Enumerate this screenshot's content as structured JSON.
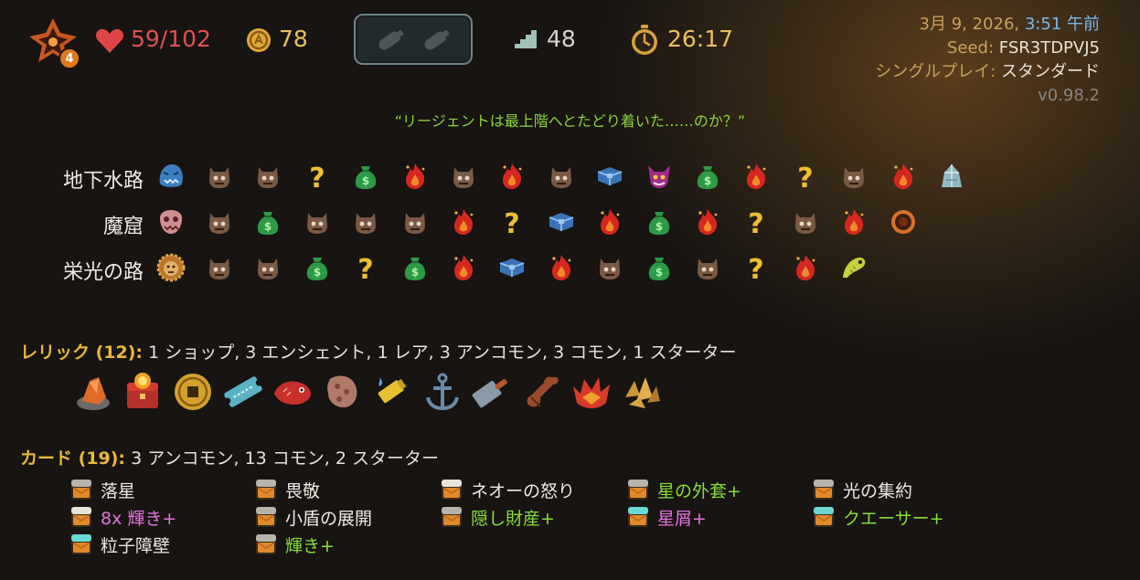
{
  "top_bar": {
    "ascension": "4",
    "hp": "59/102",
    "gold": "78",
    "floor": "48",
    "timer": "26:17",
    "potions": [
      "potion-slot-1-icon",
      "potion-slot-2-icon"
    ]
  },
  "info": {
    "date": "3月 9, 2026, ",
    "time": "3:51 午前",
    "seed_label": "Seed: ",
    "seed": "FSR3TDPVJ5",
    "mode_label": "シングルプレイ: ",
    "mode": "スタンダード",
    "version": "v0.98.2"
  },
  "quote": "“リージェントは最上階へとたどり着いた……のか？”",
  "acts": [
    {
      "name": "地下水路",
      "boss_icon": "blue-slime-boss-icon",
      "nodes": [
        "monster",
        "monster",
        "unknown",
        "shop",
        "elite",
        "monster",
        "elite",
        "monster",
        "treasure",
        "boss-imp",
        "shop",
        "elite",
        "unknown",
        "monster",
        "elite",
        "ancient-crystal"
      ]
    },
    {
      "name": "魔窟",
      "boss_icon": "pink-creature-boss-icon",
      "nodes": [
        "monster",
        "shop",
        "monster",
        "monster",
        "monster",
        "elite",
        "unknown",
        "treasure",
        "elite",
        "shop",
        "elite",
        "unknown",
        "monster",
        "elite",
        "orange-ring"
      ]
    },
    {
      "name": "栄光の路",
      "boss_icon": "golden-lion-boss-icon",
      "nodes": [
        "monster",
        "monster",
        "shop",
        "unknown",
        "shop",
        "elite",
        "treasure",
        "elite",
        "monster",
        "shop",
        "monster",
        "unknown",
        "elite",
        "yellow-eel"
      ]
    }
  ],
  "relics": {
    "label": "レリック (12):",
    "summary": " 1 ショップ,  3 エンシェント, 1 レア, 3 アンコモン, 3 コモン, 1 スターター",
    "items": [
      "ember-rock-icon",
      "red-chest-icon",
      "gold-coin-icon",
      "blue-ticket-icon",
      "red-fish-icon",
      "brown-sponge-icon",
      "lighter-icon",
      "anchor-icon",
      "cleaver-icon",
      "meat-leg-icon",
      "red-crown-flower-icon",
      "golden-shards-icon"
    ]
  },
  "cards": {
    "label": "カード (19):",
    "summary": " 3 アンコモン, 13 コモン, 2 スターター",
    "col1": [
      {
        "name": "落星",
        "style": "normal"
      },
      {
        "name": "8x 輝き+",
        "style": "magenta"
      },
      {
        "name": "粒子障壁",
        "style": "normal"
      }
    ],
    "col2": [
      {
        "name": "畏敬",
        "style": "normal"
      },
      {
        "name": "小盾の展開",
        "style": "normal"
      },
      {
        "name": "輝き+",
        "style": "up"
      }
    ],
    "col3": [
      {
        "name": "ネオーの怒り",
        "style": "normal"
      },
      {
        "name": "隠し財産+",
        "style": "up"
      }
    ],
    "col4": [
      {
        "name": "星の外套+",
        "style": "up"
      },
      {
        "name": "星屑+",
        "style": "magenta"
      }
    ],
    "col5": [
      {
        "name": "光の集約",
        "style": "normal"
      },
      {
        "name": "クエーサー+",
        "style": "up"
      }
    ]
  }
}
